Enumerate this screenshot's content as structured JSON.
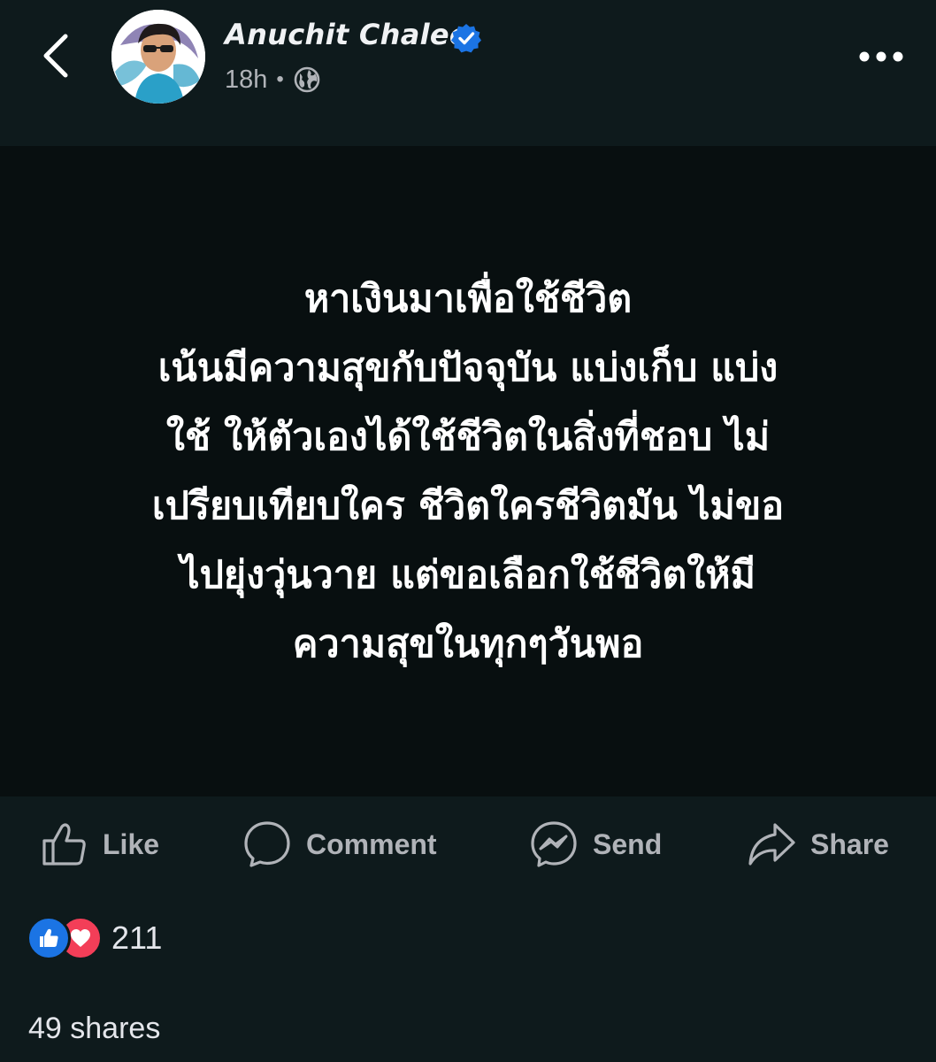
{
  "header": {
    "author_name": "Anuchit Chalee",
    "time": "18h",
    "separator": "•",
    "privacy_icon": "globe-icon",
    "verified_icon": "verified-badge-icon",
    "back_icon": "chevron-left-icon",
    "more_icon": "more-horizontal-icon"
  },
  "post": {
    "text": "หาเงินมาเพื่อใช้ชีวิต\nเน้นมีความสุขกับปัจจุบัน แบ่งเก็บ แบ่ง\nใช้ ให้ตัวเองได้ใช้ชีวิตในสิ่งที่ชอบ ไม่\nเปรียบเทียบใคร ชีวิตใครชีวิตมัน ไม่ขอ\nไปยุ่งวุ่นวาย แต่ขอเลือกใช้ชีวิตให้มี\nความสุขในทุกๆวันพอ",
    "background_color": "#080f10"
  },
  "actions": {
    "like": "Like",
    "comment": "Comment",
    "send": "Send",
    "share": "Share"
  },
  "stats": {
    "reaction_icons": [
      "like-reaction-icon",
      "love-reaction-icon"
    ],
    "reaction_count": "211",
    "shares": "49 shares"
  },
  "colors": {
    "background": "#0e1a1c",
    "verified": "#1b74e4",
    "like_reaction": "#1b74e4",
    "love_reaction": "#f33e58",
    "secondary_text": "#b0b3b8"
  }
}
